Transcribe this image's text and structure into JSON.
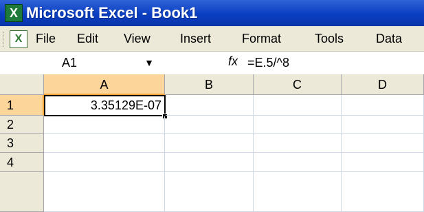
{
  "window": {
    "title": "Microsoft Excel - Book1",
    "app_icon": "excel-icon"
  },
  "menu": {
    "doc_icon": "workbook-icon",
    "items": [
      "File",
      "Edit",
      "View",
      "Insert",
      "Format",
      "Tools",
      "Data"
    ]
  },
  "formula_bar": {
    "name_box": "A1",
    "dropdown_glyph": "▼",
    "fx_label": "fx",
    "formula": "=E.5/^8"
  },
  "grid": {
    "columns": [
      "A",
      "B",
      "C",
      "D"
    ],
    "rows": [
      "1",
      "2",
      "3",
      "4"
    ],
    "selected_cell": "A1",
    "cells": {
      "A1": "3.35129E-07"
    }
  },
  "colors": {
    "title_bar": "#0a3ec2",
    "chrome": "#ece9d8",
    "active_header": "#fbd59a"
  }
}
